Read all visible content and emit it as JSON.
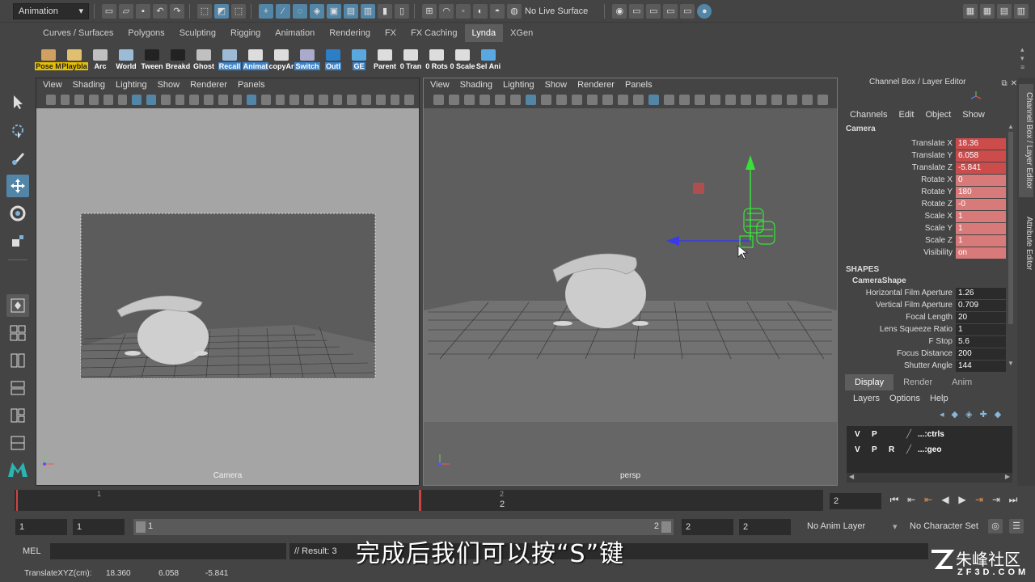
{
  "status_line": {
    "mode": "Animation",
    "live_surface": "No Live Surface"
  },
  "shelf_tabs": [
    "Curves / Surfaces",
    "Polygons",
    "Sculpting",
    "Rigging",
    "Animation",
    "Rendering",
    "FX",
    "FX Caching",
    "Lynda",
    "XGen"
  ],
  "active_shelf_tab": "Lynda",
  "shelf_buttons": [
    {
      "label": "Pose M",
      "style": "yellow"
    },
    {
      "label": "Playbla",
      "style": "yellow"
    },
    {
      "label": "Arc",
      "style": "plain"
    },
    {
      "label": "World",
      "style": "plain"
    },
    {
      "label": "Tween",
      "style": "plain"
    },
    {
      "label": "Breakd",
      "style": "plain"
    },
    {
      "label": "Ghost",
      "style": "plain"
    },
    {
      "label": "Recall",
      "style": "blue"
    },
    {
      "label": "Animat",
      "style": "blue"
    },
    {
      "label": "copyAr",
      "style": "plain"
    },
    {
      "label": "Switch",
      "style": "blue"
    },
    {
      "label": "Outl",
      "style": "blue"
    },
    {
      "label": "GE",
      "style": "blue"
    },
    {
      "label": "Parent",
      "style": "plain"
    },
    {
      "label": "0 Tran",
      "style": "plain"
    },
    {
      "label": "0 Rots",
      "style": "plain"
    },
    {
      "label": "0 Scale",
      "style": "plain"
    },
    {
      "label": "Sel Ani",
      "style": "plain"
    }
  ],
  "viewport_menu": [
    "View",
    "Shading",
    "Lighting",
    "Show",
    "Renderer",
    "Panels"
  ],
  "viewport_left": {
    "camera_label": "Camera"
  },
  "viewport_right": {
    "camera_label": "persp"
  },
  "channel_box": {
    "title": "Channel Box / Layer Editor",
    "menu": [
      "Channels",
      "Edit",
      "Object",
      "Show"
    ],
    "object_name": "Camera",
    "attributes": [
      {
        "name": "Translate X",
        "value": "18.36",
        "state": "keyed"
      },
      {
        "name": "Translate Y",
        "value": "6.058",
        "state": "keyed"
      },
      {
        "name": "Translate Z",
        "value": "-5.841",
        "state": "keyed"
      },
      {
        "name": "Rotate X",
        "value": "0",
        "state": "keyed-light"
      },
      {
        "name": "Rotate Y",
        "value": "180",
        "state": "keyed-light"
      },
      {
        "name": "Rotate Z",
        "value": "-0",
        "state": "keyed-light"
      },
      {
        "name": "Scale X",
        "value": "1",
        "state": "keyed-light"
      },
      {
        "name": "Scale Y",
        "value": "1",
        "state": "keyed-light"
      },
      {
        "name": "Scale Z",
        "value": "1",
        "state": "keyed-light"
      },
      {
        "name": "Visibility",
        "value": "on",
        "state": "keyed-light"
      }
    ],
    "shapes_header": "SHAPES",
    "shape_name": "CameraShape",
    "shape_attributes": [
      {
        "name": "Horizontal Film Aperture",
        "value": "1.26"
      },
      {
        "name": "Vertical Film Aperture",
        "value": "0.709"
      },
      {
        "name": "Focal Length",
        "value": "20"
      },
      {
        "name": "Lens Squeeze Ratio",
        "value": "1"
      },
      {
        "name": "F Stop",
        "value": "5.6"
      },
      {
        "name": "Focus Distance",
        "value": "200"
      },
      {
        "name": "Shutter Angle",
        "value": "144"
      }
    ]
  },
  "side_tabs": [
    "Channel Box / Layer Editor",
    "Attribute Editor"
  ],
  "layer_editor": {
    "tabs": [
      "Display",
      "Render",
      "Anim"
    ],
    "active_tab": "Display",
    "menu": [
      "Layers",
      "Options",
      "Help"
    ],
    "layers": [
      {
        "v": "V",
        "p": "P",
        "r": "",
        "name": "...:ctrls"
      },
      {
        "v": "V",
        "p": "P",
        "r": "R",
        "name": "...:geo"
      }
    ]
  },
  "time_slider": {
    "tick_1": "1",
    "tick_2": "2",
    "current_frame_label": "2",
    "current_frame_field": "2"
  },
  "range_slider": {
    "start_field": "1",
    "playback_start": "1",
    "range_start_label": "1",
    "range_end_label": "2",
    "playback_end": "2",
    "end_field": "2",
    "anim_layer": "No Anim Layer",
    "character_set": "No Character Set"
  },
  "command_line": {
    "language": "MEL",
    "result": "// Result: 3"
  },
  "help_line": {
    "label": "TranslateXYZ(cm):",
    "x": "18.360",
    "y": "6.058",
    "z": "-5.841"
  },
  "subtitle": "完成后我们可以按“S”键",
  "watermark": {
    "brand": "朱峰社区",
    "url": "ZF3D.COM"
  },
  "colors": {
    "accent": "#5285a6",
    "keyed": "#cc4c4c",
    "keyed_light": "#d97a7a",
    "pose_label": "#e8c000",
    "panel_bg": "#444444",
    "field_bg": "#2b2b2b"
  }
}
